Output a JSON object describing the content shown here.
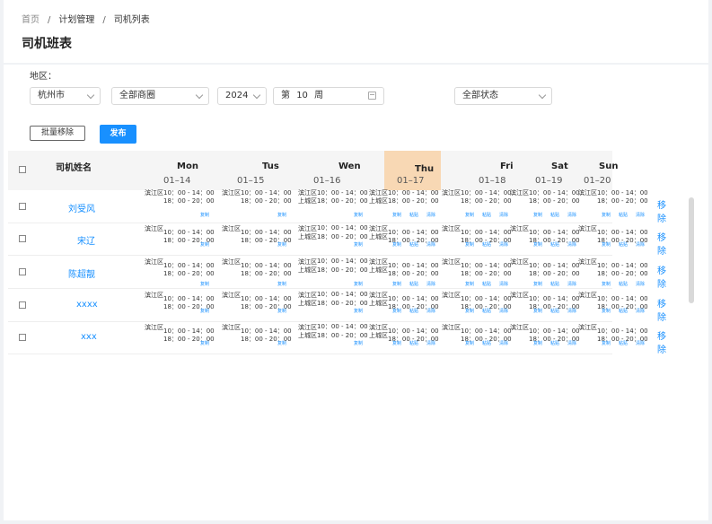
{
  "breadcrumb": [
    "首页",
    "计划管理",
    "司机列表"
  ],
  "breadcrumb_sep": "/",
  "page_title": "司机班表",
  "filters": {
    "region_label": "地区：",
    "city": "杭州市",
    "district": "全部商圈",
    "year": "2024",
    "week_prefix": "第",
    "week_num": "10",
    "week_suffix": "周",
    "status": "全部状态"
  },
  "toolbar": {
    "batch_remove": "批量移除",
    "publish": "发布"
  },
  "table": {
    "name_header": "司机姓名",
    "days": [
      {
        "day": "Mon",
        "date": "01–14"
      },
      {
        "day": "Tus",
        "date": "01–15"
      },
      {
        "day": "Wen",
        "date": "01–16"
      },
      {
        "day": "Thu",
        "date": "01–17"
      },
      {
        "day": "Fri",
        "date": "01–18"
      },
      {
        "day": "Sat",
        "date": "01–19"
      },
      {
        "day": "Sun",
        "date": "01–20"
      }
    ],
    "highlight_day": "Thu",
    "drivers": [
      "刘受风",
      "宋辽",
      "陈超靓",
      "xxxx",
      "xxx"
    ],
    "remove_label": "移除"
  },
  "cell": {
    "area1": "滨江区",
    "area2": "上城区",
    "time1": "10：00 - 14：00",
    "time2": "18：00 - 20：00",
    "copy": "复制",
    "paste": "粘贴",
    "clear": "清除"
  },
  "colors": {
    "accent": "#1890ff",
    "highlight": "#f8d8b4"
  }
}
